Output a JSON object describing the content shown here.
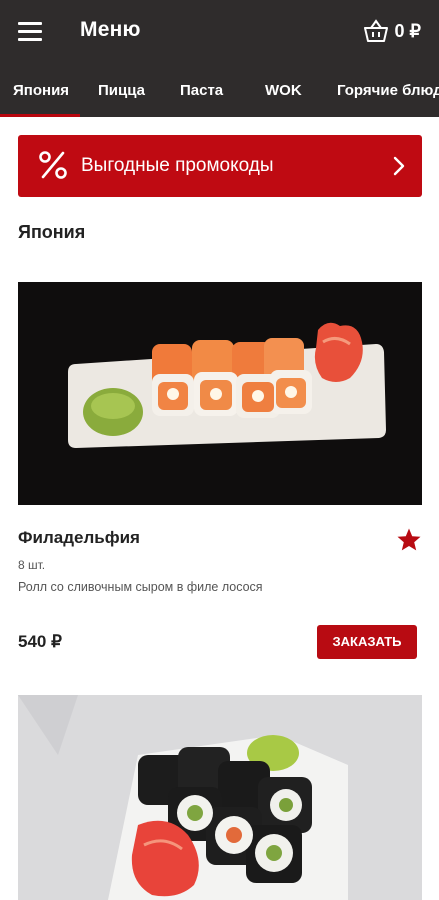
{
  "header": {
    "title": "Меню",
    "cart_amount": "0 ₽"
  },
  "tabs": [
    {
      "label": "Япония",
      "active": true
    },
    {
      "label": "Пицца"
    },
    {
      "label": "Паста"
    },
    {
      "label": "WOK"
    },
    {
      "label": "Горячие блюда"
    }
  ],
  "promo": {
    "label": "Выгодные промокоды",
    "icon": "percent-icon"
  },
  "section": {
    "title": "Япония"
  },
  "products": [
    {
      "name": "Филадельфия",
      "quantity": "8 шт.",
      "description": "Ролл со сливочным сыром в филе лосося",
      "price": "540 ₽",
      "order_label": "ЗАКАЗАТЬ",
      "favorite": true
    }
  ],
  "colors": {
    "header_bg": "#2f2c2c",
    "accent": "#bf0a12"
  }
}
